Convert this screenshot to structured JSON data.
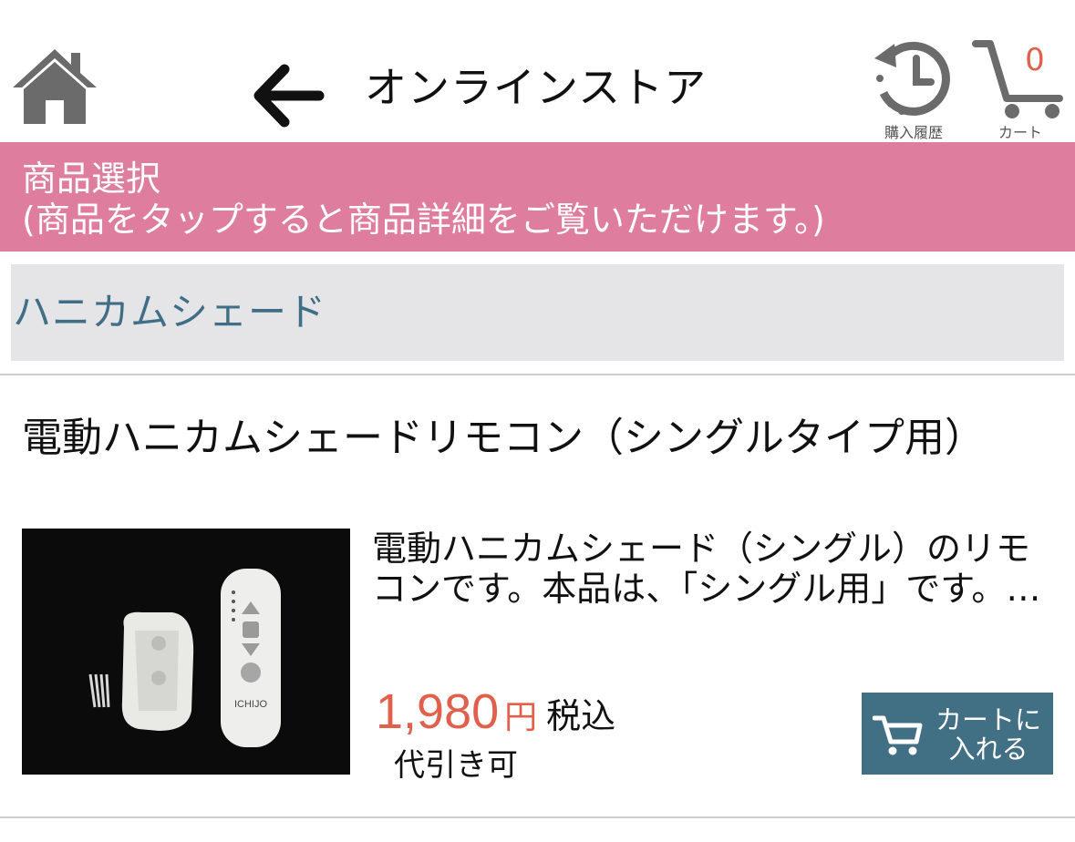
{
  "header": {
    "title": "オンラインストア",
    "history_label": "購入履歴",
    "cart_label": "カート",
    "cart_count": "0"
  },
  "banner": {
    "line1": "商品選択",
    "line2": "(商品をタップすると商品詳細をご覧いただけます。)"
  },
  "category": {
    "name": "ハニカムシェード"
  },
  "product": {
    "title": "電動ハニカムシェードリモコン（シングルタイプ用）",
    "description": "電動ハニカムシェード（シングル）のリモコンです。本品は、「シングル用」です。…",
    "price": "1,980",
    "currency": "円",
    "tax_label": "税込",
    "availability": "代引き可",
    "image_brand": "ICHIJO",
    "add_to_cart_line1": "カートに",
    "add_to_cart_line2": "入れる"
  },
  "colors": {
    "banner": "#de7d9e",
    "category_bg": "#e5e5e8",
    "category_text": "#3f6e86",
    "price": "#e0604c",
    "button": "#416f84",
    "icon": "#6b6b6b"
  },
  "icons": [
    "home-icon",
    "back-arrow-icon",
    "history-clock-icon",
    "cart-icon"
  ]
}
